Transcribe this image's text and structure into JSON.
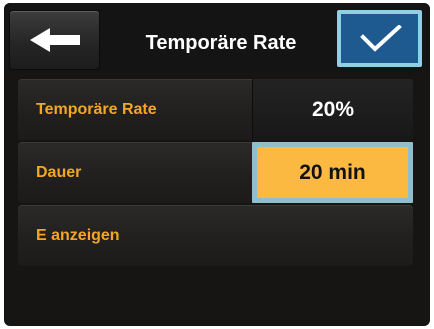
{
  "header": {
    "title": "Temporäre Rate",
    "back_icon": "arrow-left-icon",
    "confirm_icon": "checkmark-icon"
  },
  "rows": [
    {
      "label": "Temporäre Rate",
      "value": "20%"
    },
    {
      "label": "Dauer",
      "value": "20 min",
      "selected": true
    },
    {
      "label": "E anzeigen"
    }
  ],
  "colors": {
    "background": "#161514",
    "label_orange": "#f5a623",
    "selected_fill": "#fbb941",
    "selected_border": "#8fbfcf",
    "confirm_blue": "#1e5a8f",
    "confirm_border": "#8fd0e6"
  }
}
